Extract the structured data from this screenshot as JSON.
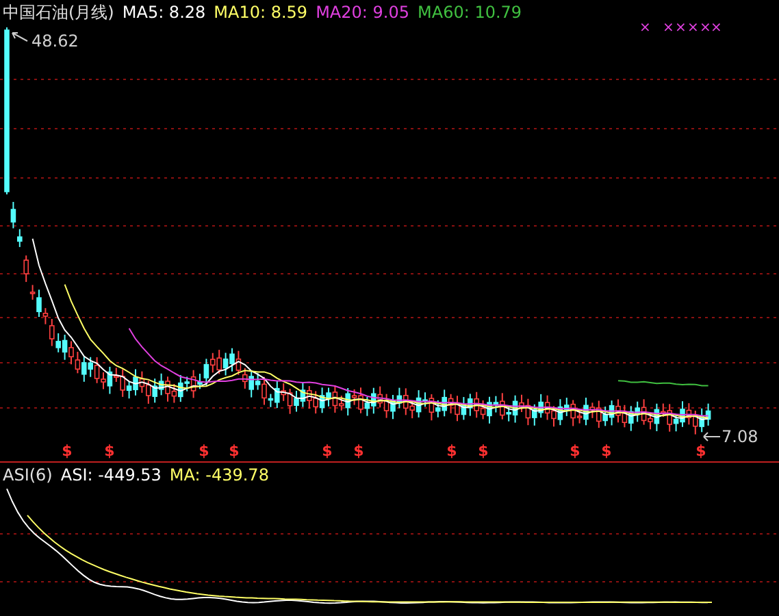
{
  "title": "中国石油(月线)",
  "moving_averages": [
    {
      "label": "MA5: 8.28",
      "color": "#ffffff"
    },
    {
      "label": "MA10: 8.59",
      "color": "#ffff66"
    },
    {
      "label": "MA20: 9.05",
      "color": "#e040e0"
    },
    {
      "label": "MA60: 10.79",
      "color": "#40c040"
    }
  ],
  "high_label": "48.62",
  "low_label": "7.08",
  "top_marks": [
    "×",
    "×",
    "×",
    "×",
    "×",
    "×"
  ],
  "signal_marks": [
    "$",
    "$",
    "$",
    "$",
    "$",
    "$",
    "$",
    "$",
    "$",
    "$",
    "$"
  ],
  "indicator": {
    "name": "ASI(6)",
    "values": [
      {
        "label": "ASI: -449.53",
        "color": "#ffffff"
      },
      {
        "label": "MA: -439.78",
        "color": "#ffff66"
      }
    ]
  }
}
